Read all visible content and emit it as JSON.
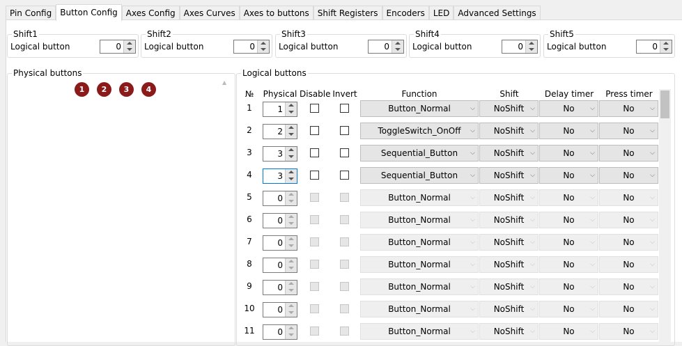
{
  "tabs": [
    "Pin Config",
    "Button Config",
    "Axes Config",
    "Axes Curves",
    "Axes to buttons",
    "Shift Registers",
    "Encoders",
    "LED",
    "Advanced Settings"
  ],
  "active_tab": "Button Config",
  "shifts": [
    {
      "title": "Shift1",
      "label": "Logical button",
      "value": "0"
    },
    {
      "title": "Shift2",
      "label": "Logical button",
      "value": "0"
    },
    {
      "title": "Shift3",
      "label": "Logical button",
      "value": "0"
    },
    {
      "title": "Shift4",
      "label": "Logical button",
      "value": "0"
    },
    {
      "title": "Shift5",
      "label": "Logical button",
      "value": "0"
    }
  ],
  "physical": {
    "title": "Physical buttons",
    "buttons": [
      "1",
      "2",
      "3",
      "4"
    ]
  },
  "logical": {
    "title": "Logical buttons",
    "headers": {
      "no": "№",
      "physical": "Physical",
      "disable": "Disable",
      "invert": "Invert",
      "function": "Function",
      "shift": "Shift",
      "delay": "Delay timer",
      "press": "Press timer"
    },
    "rows": [
      {
        "no": "1",
        "physical": "1",
        "function": "Button_Normal",
        "shift": "NoShift",
        "delay": "No",
        "press": "No",
        "enabled": true
      },
      {
        "no": "2",
        "physical": "2",
        "function": "ToggleSwitch_OnOff",
        "shift": "NoShift",
        "delay": "No",
        "press": "No",
        "enabled": true
      },
      {
        "no": "3",
        "physical": "3",
        "function": "Sequential_Button",
        "shift": "NoShift",
        "delay": "No",
        "press": "No",
        "enabled": true
      },
      {
        "no": "4",
        "physical": "3",
        "function": "Sequential_Button",
        "shift": "NoShift",
        "delay": "No",
        "press": "No",
        "enabled": true
      },
      {
        "no": "5",
        "physical": "0",
        "function": "Button_Normal",
        "shift": "NoShift",
        "delay": "No",
        "press": "No",
        "enabled": false
      },
      {
        "no": "6",
        "physical": "0",
        "function": "Button_Normal",
        "shift": "NoShift",
        "delay": "No",
        "press": "No",
        "enabled": false
      },
      {
        "no": "7",
        "physical": "0",
        "function": "Button_Normal",
        "shift": "NoShift",
        "delay": "No",
        "press": "No",
        "enabled": false
      },
      {
        "no": "8",
        "physical": "0",
        "function": "Button_Normal",
        "shift": "NoShift",
        "delay": "No",
        "press": "No",
        "enabled": false
      },
      {
        "no": "9",
        "physical": "0",
        "function": "Button_Normal",
        "shift": "NoShift",
        "delay": "No",
        "press": "No",
        "enabled": false
      },
      {
        "no": "10",
        "physical": "0",
        "function": "Button_Normal",
        "shift": "NoShift",
        "delay": "No",
        "press": "No",
        "enabled": false
      },
      {
        "no": "11",
        "physical": "0",
        "function": "Button_Normal",
        "shift": "NoShift",
        "delay": "No",
        "press": "No",
        "enabled": false
      }
    ]
  },
  "colors": {
    "physical_button": "#8b1a1a",
    "active_border": "#0078d7"
  }
}
